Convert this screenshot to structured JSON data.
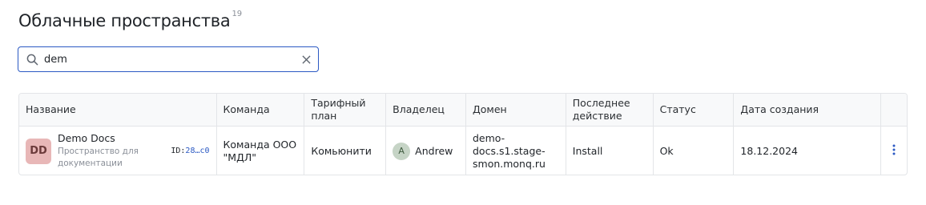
{
  "page": {
    "title": "Облачные пространства",
    "count": "19"
  },
  "search": {
    "value": "dem",
    "placeholder": ""
  },
  "table": {
    "columns": [
      "Название",
      "Команда",
      "Тарифный план",
      "Владелец",
      "Домен",
      "Последнее действие",
      "Статус",
      "Дата создания"
    ],
    "rows": [
      {
        "avatar_initials": "DD",
        "name": "Demo Docs",
        "description": "Пространство для документации",
        "id_label": "ID:",
        "id_value": "28…c0",
        "team": "Команда ООО \"МДЛ\"",
        "plan": "Комьюнити",
        "owner_initial": "A",
        "owner_name": "Andrew",
        "domain": "demo-docs.s1.stage-smon.monq.ru",
        "last_action": "Install",
        "status": "Ok",
        "created": "18.12.2024"
      }
    ]
  },
  "colors": {
    "accent": "#2b59c3",
    "avatar_bg": "#e8b7b7",
    "owner_avatar_bg": "#c6d4c6"
  },
  "icons": {
    "search": "search-icon",
    "clear": "close-icon",
    "row_menu": "more-vertical-icon"
  }
}
